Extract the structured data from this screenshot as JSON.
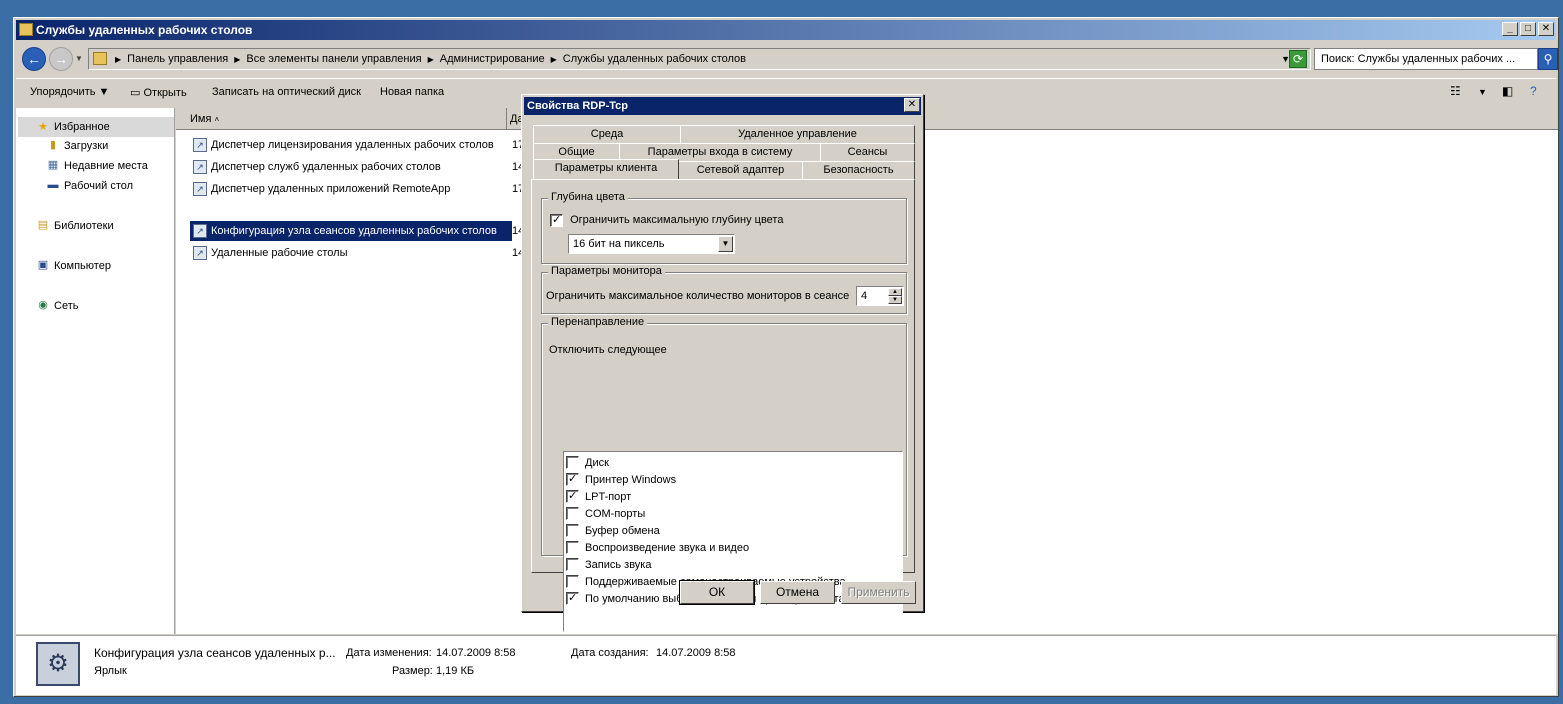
{
  "window": {
    "title": "Службы удаленных рабочих столов",
    "minimize": "_",
    "maximize": "□",
    "close": "✕"
  },
  "address": {
    "crumbs": [
      "Панель управления",
      "Все элементы панели управления",
      "Администрирование",
      "Службы удаленных рабочих столов"
    ],
    "search_placeholder": "Поиск: Службы удаленных рабочих ..."
  },
  "toolbar": {
    "organize": "Упорядочить",
    "open": "Открыть",
    "burn": "Записать на оптический диск",
    "new_folder": "Новая папка"
  },
  "nav": {
    "favorites": "Избранное",
    "downloads": "Загрузки",
    "recent": "Недавние места",
    "desktop": "Рабочий стол",
    "libraries": "Библиотеки",
    "computer": "Компьютер",
    "network": "Сеть"
  },
  "columns": {
    "name": "Имя",
    "date": "Да"
  },
  "files": [
    {
      "name": "Диспетчер лицензирования удаленных рабочих столов",
      "date": "17"
    },
    {
      "name": "Диспетчер служб удаленных рабочих столов",
      "date": "14"
    },
    {
      "name": "Диспетчер удаленных приложений RemoteApp",
      "date": "17"
    },
    {
      "name": "Конфигурация узла сеансов удаленных рабочих столов",
      "date": "14"
    },
    {
      "name": "Удаленные рабочие столы",
      "date": "14"
    }
  ],
  "details": {
    "name": "Конфигурация узла сеансов удаленных р...",
    "type": "Ярлык",
    "modified_label": "Дата изменения:",
    "modified_value": "14.07.2009 8:58",
    "size_label": "Размер:",
    "size_value": "1,19 КБ",
    "created_label": "Дата создания:",
    "created_value": "14.07.2009 8:58"
  },
  "dialog": {
    "title": "Свойства RDP-Tcp",
    "close": "✕",
    "tabs": {
      "env": "Среда",
      "remote": "Удаленное управление",
      "general": "Общие",
      "logon": "Параметры входа в систему",
      "sessions": "Сеансы",
      "client": "Параметры клиента",
      "adapter": "Сетевой адаптер",
      "security": "Безопасность"
    },
    "color": {
      "group": "Глубина цвета",
      "limit_label": "Ограничить максимальную глубину цвета",
      "limit_checked": true,
      "depth_value": "16 бит на пиксель"
    },
    "monitor": {
      "group": "Параметры монитора",
      "label": "Ограничить максимальное количество мониторов в сеансе",
      "value": "4"
    },
    "redirect": {
      "group": "Перенаправление",
      "disable_label": "Отключить следующее",
      "items": [
        {
          "label": "Диск",
          "checked": false
        },
        {
          "label": "Принтер Windows",
          "checked": true
        },
        {
          "label": "LPT-порт",
          "checked": true
        },
        {
          "label": "COM-порты",
          "checked": false
        },
        {
          "label": "Буфер обмена",
          "checked": false
        },
        {
          "label": "Воспроизведение звука и видео",
          "checked": false
        },
        {
          "label": "Запись звука",
          "checked": false
        },
        {
          "label": "Поддерживаемые самонастраиваемые устройства",
          "checked": false
        },
        {
          "label": "По умолчанию выбрать основной принтер клиента",
          "checked": true
        }
      ]
    },
    "buttons": {
      "ok": "ОК",
      "cancel": "Отмена",
      "apply": "Применить"
    }
  }
}
